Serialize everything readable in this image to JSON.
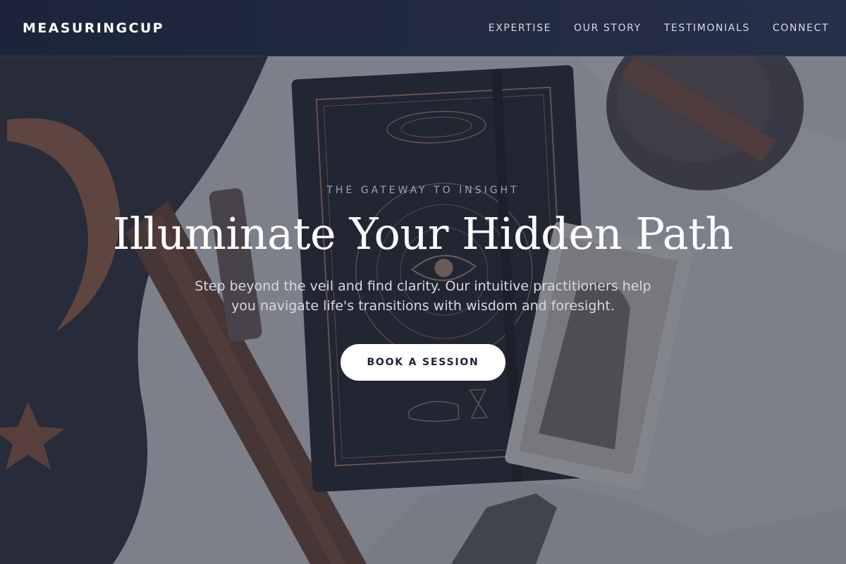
{
  "nav": {
    "brand": "MEASURINGCUP",
    "links": [
      {
        "label": "EXPERTISE"
      },
      {
        "label": "OUR STORY"
      },
      {
        "label": "TESTIMONIALS"
      },
      {
        "label": "CONNECT"
      }
    ]
  },
  "hero": {
    "eyebrow": "THE GATEWAY TO INSIGHT",
    "headline": "Illuminate Your Hidden Path",
    "subtext": "Step beyond the veil and find clarity. Our intuitive practitioners help you navigate life's transitions with wisdom and foresight.",
    "cta_label": "BOOK A SESSION"
  },
  "colors": {
    "nav_bg": "#1b2438",
    "overlay": "#282e42",
    "cta_bg": "#ffffff",
    "cta_text": "#1a2236",
    "headline": "#ffffff"
  },
  "background_image": {
    "icons": [
      "moon-icon",
      "star-icon",
      "eye-icon",
      "hand-icon",
      "hourglass-icon"
    ]
  }
}
